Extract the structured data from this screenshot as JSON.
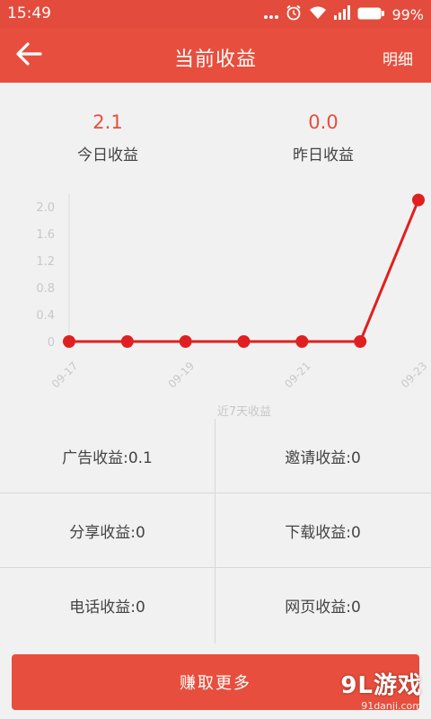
{
  "status_bar": {
    "time": "15:49",
    "battery": "99%",
    "icons": [
      "more-dots-icon",
      "alarm-icon",
      "wifi-icon",
      "signal-icon",
      "battery-icon"
    ]
  },
  "header": {
    "title": "当前收益",
    "detail_label": "明细",
    "back_icon": "back-arrow-icon"
  },
  "summary": {
    "today": {
      "value": "2.1",
      "label": "今日收益"
    },
    "yesterday": {
      "value": "0.0",
      "label": "昨日收益"
    }
  },
  "chart_data": {
    "type": "line",
    "x": [
      "09-17",
      "09-18",
      "09-19",
      "09-20",
      "09-21",
      "09-22",
      "09-23"
    ],
    "x_tick_labels": [
      "09-17",
      "09-19",
      "09-21",
      "09-23"
    ],
    "series": [
      {
        "values": [
          0,
          0,
          0,
          0,
          0,
          0,
          2.1
        ]
      }
    ],
    "y_ticks": [
      "0",
      "0.4",
      "0.8",
      "1.2",
      "1.6",
      "2.0"
    ],
    "ylim": [
      0,
      2.1
    ],
    "xlabel": "近7天收益",
    "ylabel": "",
    "grid": false,
    "line_color": "#e02020"
  },
  "stats": [
    {
      "label": "广告收益:0.1"
    },
    {
      "label": "邀请收益:0"
    },
    {
      "label": "分享收益:0"
    },
    {
      "label": "下载收益:0"
    },
    {
      "label": "电话收益:0"
    },
    {
      "label": "网页收益:0"
    }
  ],
  "earn_button": {
    "label": "赚取更多"
  },
  "watermark": {
    "main": "9L游戏",
    "sub": "91danji.com"
  },
  "colors": {
    "accent": "#e84e3d",
    "status_bar": "#e34c3c",
    "background": "#f1f1f1"
  }
}
